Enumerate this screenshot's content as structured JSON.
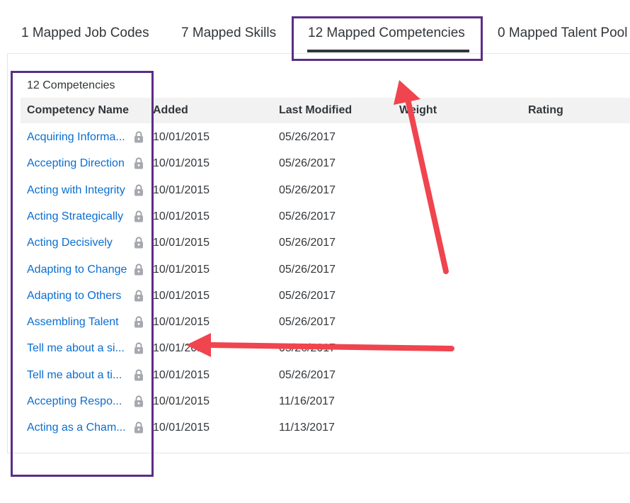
{
  "tabs": [
    {
      "label": "1 Mapped Job Codes"
    },
    {
      "label": "7 Mapped Skills"
    },
    {
      "label": "12 Mapped Competencies"
    },
    {
      "label": "0 Mapped Talent Pool"
    }
  ],
  "table": {
    "count_label": "12 Competencies",
    "headers": {
      "name": "Competency Name",
      "added": "Added",
      "modified": "Last Modified",
      "weight": "Weight",
      "rating": "Rating"
    },
    "rows": [
      {
        "name": "Acquiring Informa...",
        "added": "10/01/2015",
        "modified": "05/26/2017"
      },
      {
        "name": "Accepting Direction",
        "added": "10/01/2015",
        "modified": "05/26/2017"
      },
      {
        "name": "Acting with Integrity",
        "added": "10/01/2015",
        "modified": "05/26/2017"
      },
      {
        "name": "Acting Strategically",
        "added": "10/01/2015",
        "modified": "05/26/2017"
      },
      {
        "name": "Acting Decisively",
        "added": "10/01/2015",
        "modified": "05/26/2017"
      },
      {
        "name": "Adapting to Change",
        "added": "10/01/2015",
        "modified": "05/26/2017"
      },
      {
        "name": "Adapting to Others",
        "added": "10/01/2015",
        "modified": "05/26/2017"
      },
      {
        "name": "Assembling Talent",
        "added": "10/01/2015",
        "modified": "05/26/2017"
      },
      {
        "name": "Tell me about a si...",
        "added": "10/01/2015",
        "modified": "05/26/2017"
      },
      {
        "name": "Tell me about a ti...",
        "added": "10/01/2015",
        "modified": "05/26/2017"
      },
      {
        "name": "Accepting Respo...",
        "added": "10/01/2015",
        "modified": "11/16/2017"
      },
      {
        "name": "Acting as a Cham...",
        "added": "10/01/2015",
        "modified": "11/13/2017"
      }
    ]
  },
  "colors": {
    "link": "#0a6ed1",
    "highlight_box": "#5b2d86",
    "arrow": "#f0444e",
    "header_bg": "#f2f2f2"
  },
  "icons": {
    "row_icon": "lock-icon",
    "annotation": "arrow-icon"
  }
}
